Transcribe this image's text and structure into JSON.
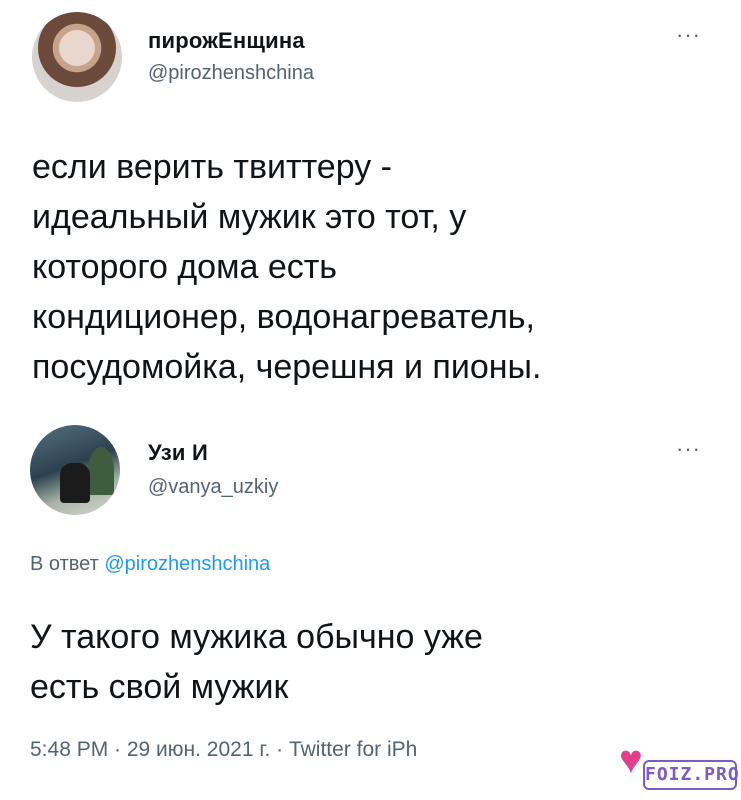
{
  "tweet1": {
    "display_name": "пирожЕнщина",
    "handle": "@pirozhenshchina",
    "more": "···",
    "text_lines": [
      "если верить твиттеру -",
      "идеальный мужик это тот, у",
      "которого дома есть",
      "кондиционер, водонагреватель,",
      "посудомойка, черешня и пионы."
    ]
  },
  "tweet2": {
    "display_name": "Узи И",
    "handle": "@vanya_uzkiy",
    "more": "···",
    "reply_prefix": "В ответ",
    "reply_mention": "@pirozhenshchina",
    "text_lines": [
      "У такого мужика обычно уже",
      "есть свой мужик"
    ],
    "meta": "5:48 PM · 29 июн. 2021 г. · Twitter for iPh"
  },
  "watermark": {
    "icon": "heart-icon",
    "text": "FOIZ.PRO"
  },
  "colors": {
    "text": "#0f1419",
    "secondary": "#536471",
    "link": "#1d9bf0",
    "watermark": "#7c5bc9",
    "heart": "#e23f8d"
  }
}
